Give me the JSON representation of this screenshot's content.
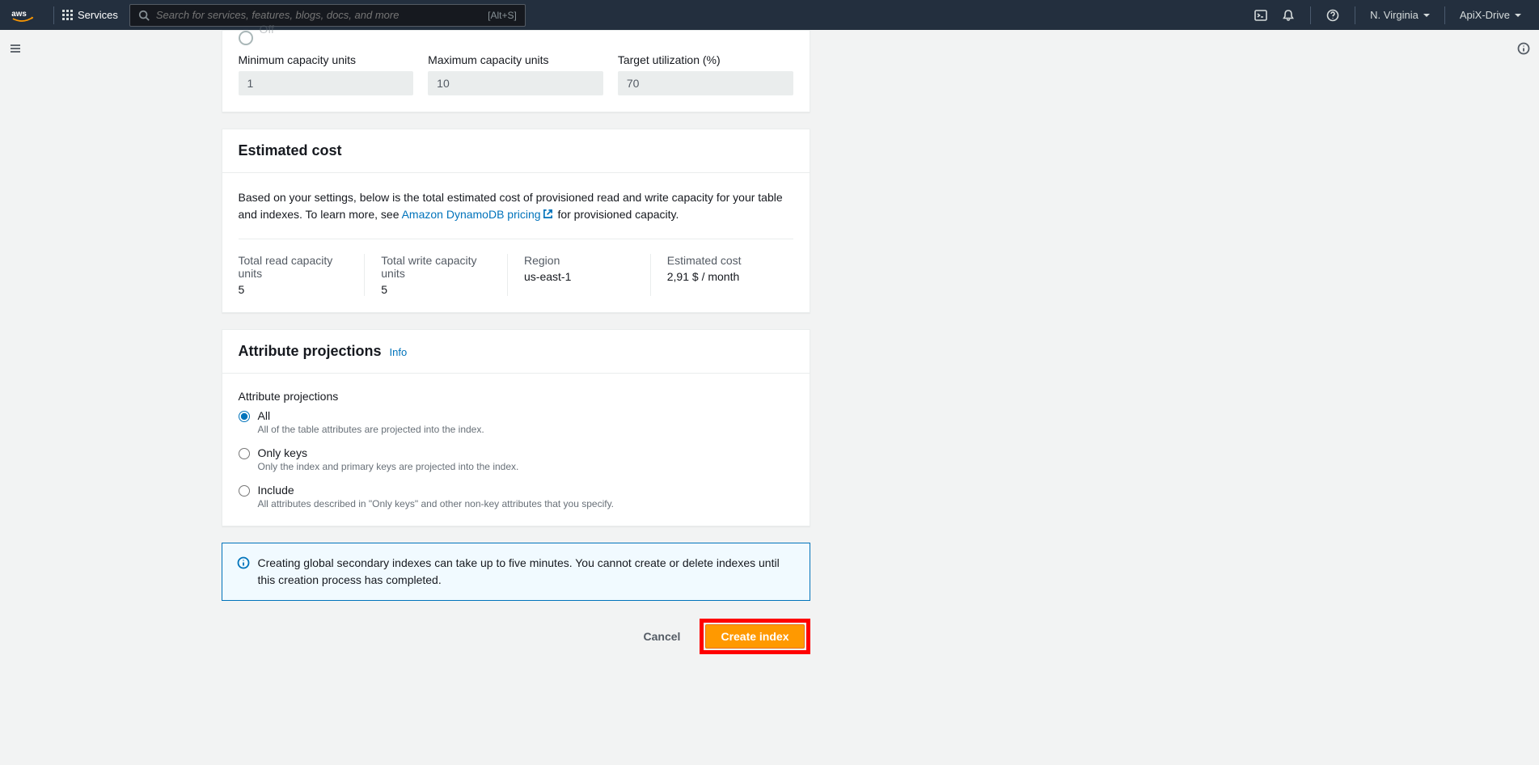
{
  "nav": {
    "services_label": "Services",
    "search_placeholder": "Search for services, features, blogs, docs, and more",
    "search_shortcut": "[Alt+S]",
    "region": "N. Virginia",
    "account": "ApiX-Drive"
  },
  "capacity": {
    "off_label": "Off",
    "min_label": "Minimum capacity units",
    "min_value": "1",
    "max_label": "Maximum capacity units",
    "max_value": "10",
    "target_label": "Target utilization (%)",
    "target_value": "70"
  },
  "cost_panel": {
    "title": "Estimated cost",
    "desc_pre": "Based on your settings, below is the total estimated cost of provisioned read and write capacity for your table and indexes. To learn more, see ",
    "link_text": "Amazon DynamoDB pricing",
    "desc_post": " for provisioned capacity.",
    "cells": {
      "read_label": "Total read capacity units",
      "read_value": "5",
      "write_label": "Total write capacity units",
      "write_value": "5",
      "region_label": "Region",
      "region_value": "us-east-1",
      "cost_label": "Estimated cost",
      "cost_value": "2,91 $ / month"
    }
  },
  "projections": {
    "title": "Attribute projections",
    "info": "Info",
    "label": "Attribute projections",
    "options": {
      "all_title": "All",
      "all_desc": "All of the table attributes are projected into the index.",
      "keys_title": "Only keys",
      "keys_desc": "Only the index and primary keys are projected into the index.",
      "include_title": "Include",
      "include_desc": "All attributes described in \"Only keys\" and other non-key attributes that you specify."
    }
  },
  "alert": {
    "text": "Creating global secondary indexes can take up to five minutes. You cannot create or delete indexes until this creation process has completed."
  },
  "actions": {
    "cancel": "Cancel",
    "create": "Create index"
  }
}
